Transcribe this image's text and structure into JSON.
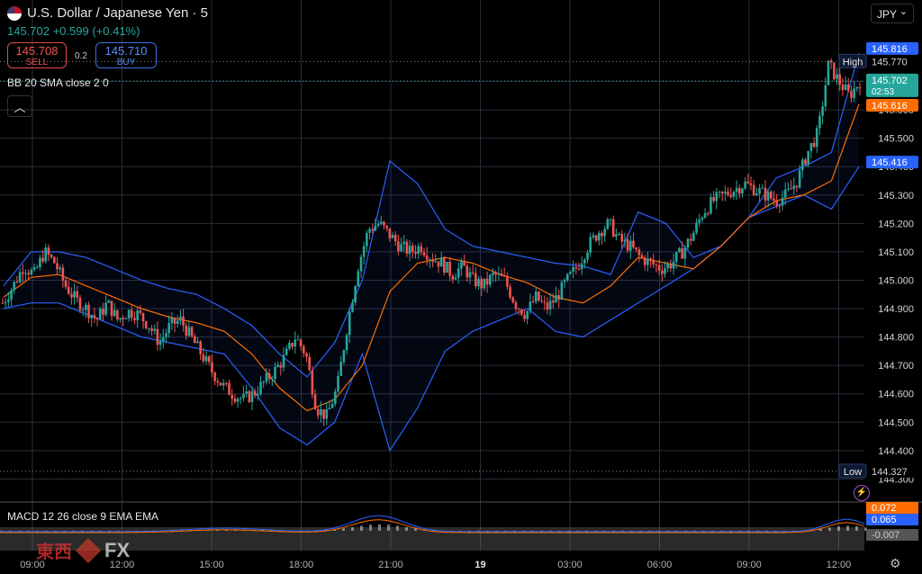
{
  "header": {
    "title": "U.S. Dollar / Japanese Yen · 5",
    "last_line": "145.702 +0.599 (+0.41%)",
    "sell_price": "145.708",
    "sell_label": "SELL",
    "buy_price": "145.710",
    "buy_label": "BUY",
    "spread": "0.2",
    "indicator_label": "BB 20 SMA close 2 0",
    "macd_label": "MACD 12 26 close 9 EMA EMA",
    "currency": "JPY",
    "collapse_icon": "chevron-up-icon"
  },
  "brand": {
    "text_cn": "東西",
    "text_fx": "FX"
  },
  "colors": {
    "up": "#26a69a",
    "down": "#ef5350",
    "band": "#2962ff",
    "basis": "#ff6d00",
    "macd": "#2962ff",
    "signal": "#ff6d00"
  },
  "chart_data": {
    "type": "candlestick",
    "y_range": [
      144.26,
      145.86
    ],
    "y_ticks": [
      "144.300",
      "144.400",
      "144.500",
      "144.600",
      "144.700",
      "144.800",
      "144.900",
      "145.000",
      "145.100",
      "145.200",
      "145.300",
      "145.400",
      "145.500",
      "145.600",
      "145.700"
    ],
    "x_ticks": [
      "09:00",
      "12:00",
      "15:00",
      "18:00",
      "21:00",
      "19",
      "03:00",
      "06:00",
      "09:00",
      "12:00"
    ],
    "close_path": [
      144.92,
      144.98,
      145.05,
      145.02,
      145.1,
      145.06,
      144.98,
      144.93,
      144.9,
      144.86,
      144.92,
      144.86,
      144.89,
      144.88,
      144.84,
      144.78,
      144.84,
      144.86,
      144.8,
      144.74,
      144.68,
      144.63,
      144.6,
      144.58,
      144.6,
      144.64,
      144.68,
      144.73,
      144.8,
      144.74,
      144.55,
      144.52,
      144.62,
      144.85,
      145.05,
      145.18,
      145.2,
      145.16,
      145.12,
      145.1,
      145.12,
      145.08,
      145.06,
      145.02,
      145.05,
      145.0,
      144.98,
      145.02,
      145.0,
      144.92,
      144.88,
      144.94,
      144.9,
      144.94,
      145.0,
      145.05,
      145.12,
      145.17,
      145.2,
      145.14,
      145.12,
      145.08,
      145.06,
      145.04,
      145.06,
      145.1,
      145.16,
      145.24,
      145.28,
      145.3,
      145.32,
      145.34,
      145.32,
      145.3,
      145.28,
      145.3,
      145.35,
      145.45,
      145.52,
      145.76,
      145.7,
      145.65,
      145.7
    ],
    "bands": {
      "upper": [
        144.98,
        145.1,
        145.1,
        145.08,
        145.04,
        145.0,
        144.97,
        144.95,
        144.9,
        144.84,
        144.74,
        144.66,
        144.78,
        145.0,
        145.42,
        145.34,
        145.18,
        145.12,
        145.1,
        145.08,
        145.06,
        145.05,
        145.02,
        145.24,
        145.2,
        145.08,
        145.12,
        145.22,
        145.36,
        145.4,
        145.45,
        145.8
      ],
      "lower": [
        144.9,
        144.92,
        144.92,
        144.88,
        144.84,
        144.8,
        144.78,
        144.76,
        144.74,
        144.62,
        144.48,
        144.42,
        144.5,
        144.74,
        144.4,
        144.55,
        144.75,
        144.82,
        144.86,
        144.9,
        144.82,
        144.8,
        144.86,
        144.92,
        144.98,
        145.04,
        145.12,
        145.22,
        145.26,
        145.3,
        145.25,
        145.4
      ],
      "basis": [
        144.94,
        145.01,
        145.02,
        144.98,
        144.94,
        144.9,
        144.87,
        144.85,
        144.82,
        144.74,
        144.62,
        144.54,
        144.58,
        144.7,
        144.96,
        145.06,
        145.08,
        145.06,
        145.02,
        144.99,
        144.94,
        144.92,
        144.98,
        145.08,
        145.06,
        145.04,
        145.12,
        145.22,
        145.28,
        145.3,
        145.35,
        145.62
      ]
    },
    "price_labels": [
      {
        "text": "145.816",
        "kind": "band",
        "value": 145.816
      },
      {
        "text": "145.770",
        "kind": "plain",
        "value": 145.77,
        "tag": "High"
      },
      {
        "text": "145.702",
        "kind": "last",
        "value": 145.702,
        "sub": "02:53"
      },
      {
        "text": "145.616",
        "kind": "basis",
        "value": 145.616
      },
      {
        "text": "145.416",
        "kind": "band",
        "value": 145.416
      },
      {
        "text": "144.327",
        "kind": "plain",
        "value": 144.327,
        "tag": "Low"
      }
    ],
    "macd": {
      "labels": [
        "0.072",
        "0.065",
        "-0.007"
      ]
    }
  }
}
